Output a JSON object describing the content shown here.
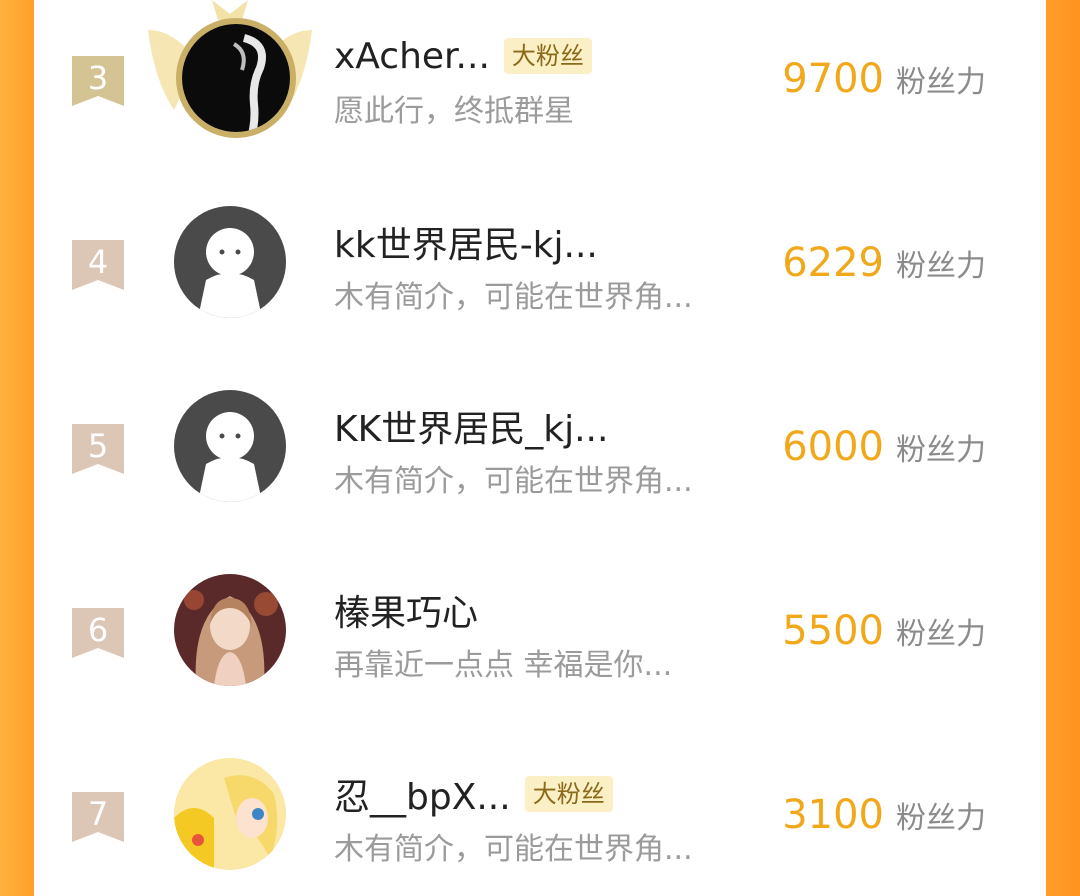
{
  "accent_color": "#f1a91b",
  "side_color": "#ff9f2a",
  "unit_label": "粉丝力",
  "rows": [
    {
      "rank": "3",
      "name": "xAcher...",
      "badge": "大粉丝",
      "bio": "愿此行，终抵群星",
      "score": "9700",
      "avatar": "crowned-dark-avatar-icon"
    },
    {
      "rank": "4",
      "name": "kk世界居民-kj...",
      "badge": "",
      "bio": "木有简介，可能在世界角...",
      "score": "6229",
      "avatar": "default-avatar-icon"
    },
    {
      "rank": "5",
      "name": "KK世界居民_kj...",
      "badge": "",
      "bio": "木有简介，可能在世界角...",
      "score": "6000",
      "avatar": "default-avatar-icon"
    },
    {
      "rank": "6",
      "name": "榛果巧心",
      "badge": "",
      "bio": "再靠近一点点 幸福是你...",
      "score": "5500",
      "avatar": "girl-portrait-avatar"
    },
    {
      "rank": "7",
      "name": "忍__bpX...",
      "badge": "大粉丝",
      "bio": "木有简介，可能在世界角...",
      "score": "3100",
      "avatar": "anime-pikachu-avatar"
    }
  ]
}
